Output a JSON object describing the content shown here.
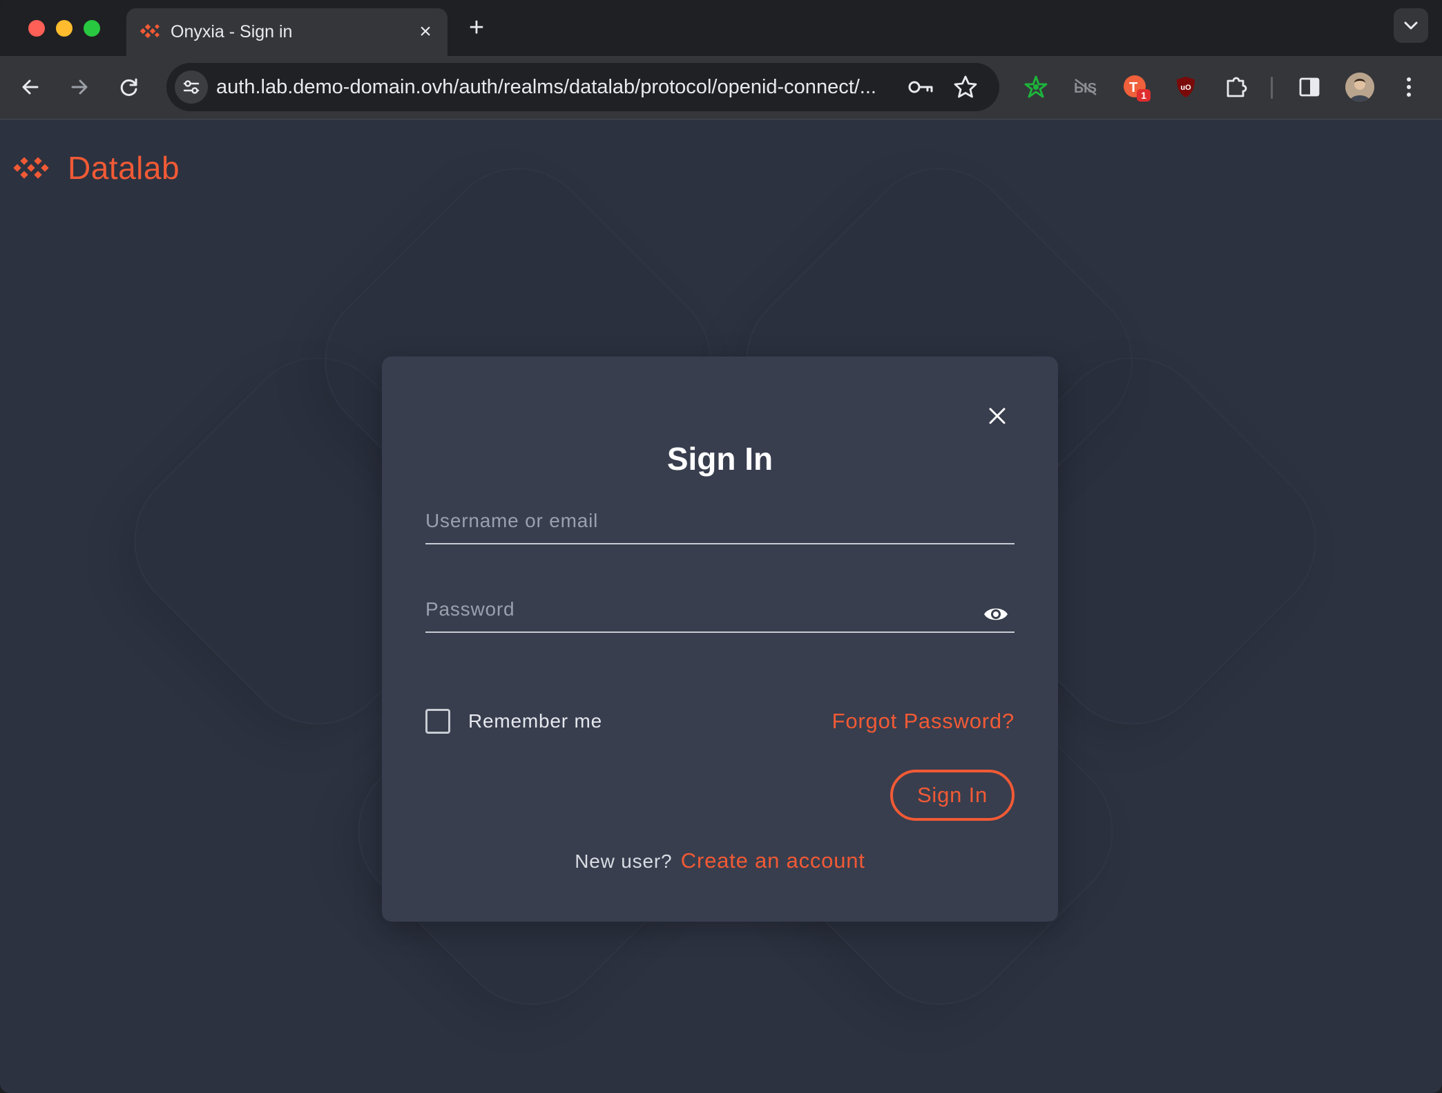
{
  "browser": {
    "tab_title": "Onyxia - Sign in",
    "url": "auth.lab.demo-domain.ovh/auth/realms/datalab/protocol/openid-connect/...",
    "extension_badge": "1"
  },
  "brand": {
    "name": "Datalab",
    "accent_color": "#f25a35"
  },
  "login": {
    "title": "Sign In",
    "username_placeholder": "Username or email",
    "password_placeholder": "Password",
    "remember_label": "Remember me",
    "forgot_label": "Forgot Password?",
    "submit_label": "Sign In",
    "new_user_label": "New user?",
    "create_account_label": "Create an account"
  },
  "colors": {
    "page_background": "#2c3240",
    "dialog_background": "#383e4e"
  }
}
